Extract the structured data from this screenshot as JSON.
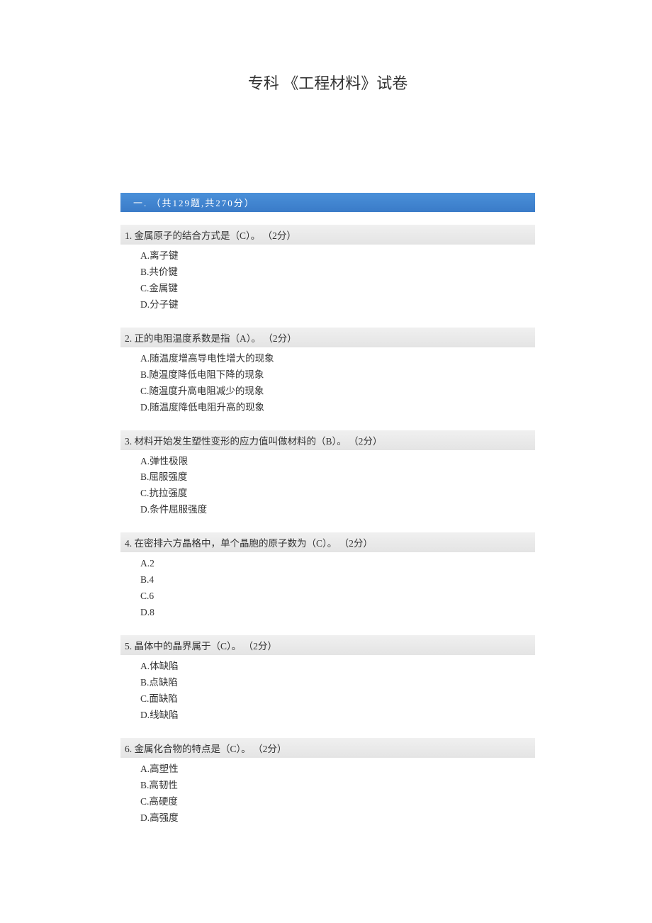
{
  "title": "专科 《工程材料》试卷",
  "section": {
    "label": "一.",
    "meta": "（共129题,共270分）"
  },
  "questions": [
    {
      "num": "1.",
      "stem": "金属原子的结合方式是（C）。",
      "points": "（2分）",
      "options": [
        "A.离子键",
        "B.共价键",
        "C.金属键",
        "D.分子键"
      ]
    },
    {
      "num": "2.",
      "stem": "正的电阻温度系数是指（A）。",
      "points": "（2分）",
      "options": [
        "A.随温度增高导电性增大的现象",
        "B.随温度降低电阻下降的现象",
        "C.随温度升高电阻减少的现象",
        "D.随温度降低电阻升高的现象"
      ]
    },
    {
      "num": "3.",
      "stem": "材料开始发生塑性变形的应力值叫做材料的（B）。",
      "points": "（2分）",
      "options": [
        "A.弹性极限",
        "B.屈服强度",
        "C.抗拉强度",
        "D.条件屈服强度"
      ]
    },
    {
      "num": "4.",
      "stem": "在密排六方晶格中，单个晶胞的原子数为（C）。",
      "points": "（2分）",
      "options": [
        "A.2",
        "B.4",
        "C.6",
        "D.8"
      ]
    },
    {
      "num": "5.",
      "stem": "晶体中的晶界属于（C）。",
      "points": "（2分）",
      "options": [
        "A.体缺陷",
        "B.点缺陷",
        "C.面缺陷",
        "D.线缺陷"
      ]
    },
    {
      "num": "6.",
      "stem": "金属化合物的特点是（C）。",
      "points": "（2分）",
      "options": [
        "A.高塑性",
        "B.高韧性",
        "C.高硬度",
        "D.高强度"
      ]
    }
  ]
}
